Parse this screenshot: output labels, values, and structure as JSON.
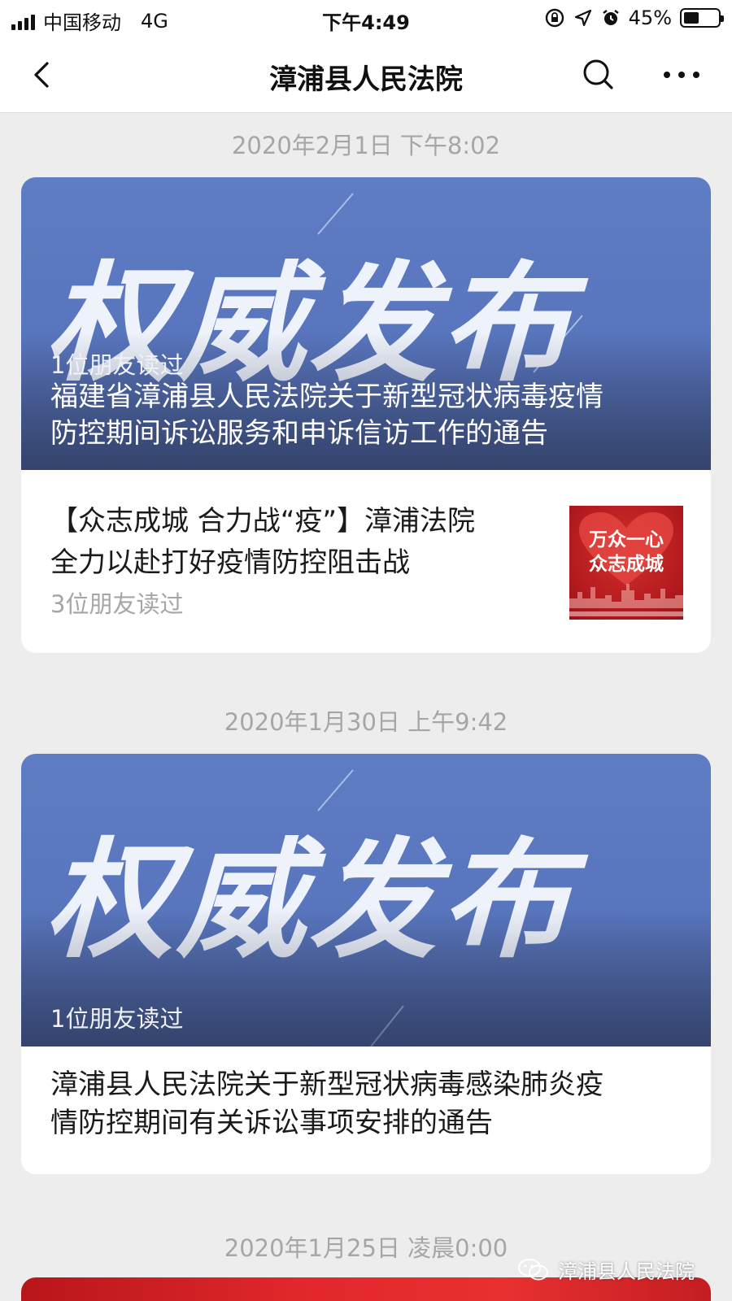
{
  "status_bar": {
    "carrier": "中国移动",
    "network": "4G",
    "time": "下午4:49",
    "battery_percent": "45%",
    "battery_level": 0.45
  },
  "nav": {
    "title": "漳浦县人民法院",
    "icons": [
      "chevron-left-icon",
      "search-icon",
      "more-icon"
    ]
  },
  "feed": [
    {
      "timestamp": "2020年2月1日 下午8:02",
      "cover_art_text": "权威发布",
      "cover_readers": "1位朋友读过",
      "cover_title_line1": "福建省漳浦县人民法院关于新型冠状病毒疫情",
      "cover_title_line2": "防控期间诉讼服务和申诉信访工作的通告",
      "sub_article": {
        "title_line1": "【众志成城  合力战“疫”】漳浦法院",
        "title_line2": "全力以赴打好疫情防控阻击战",
        "readers": "3位朋友读过",
        "thumbnail_line1": "万众一心",
        "thumbnail_line2": "众志成城"
      }
    },
    {
      "timestamp": "2020年1月30日 上午9:42",
      "cover_art_text": "权威发布",
      "cover_readers": "1位朋友读过",
      "title_line1": "漳浦县人民法院关于新型冠状病毒感染肺炎疫",
      "title_line2": "情防控期间有关诉讼事项安排的通告"
    },
    {
      "timestamp": "2020年1月25日 凌晨0:00"
    }
  ],
  "watermark": {
    "text": "漳浦县人民法院",
    "icon": "wechat-icon"
  },
  "colors": {
    "background": "#ededed",
    "cover_blue": "#5f7dc4",
    "timestamp_gray": "#a6a6a6",
    "thumbnail_red": "#c41e22"
  }
}
